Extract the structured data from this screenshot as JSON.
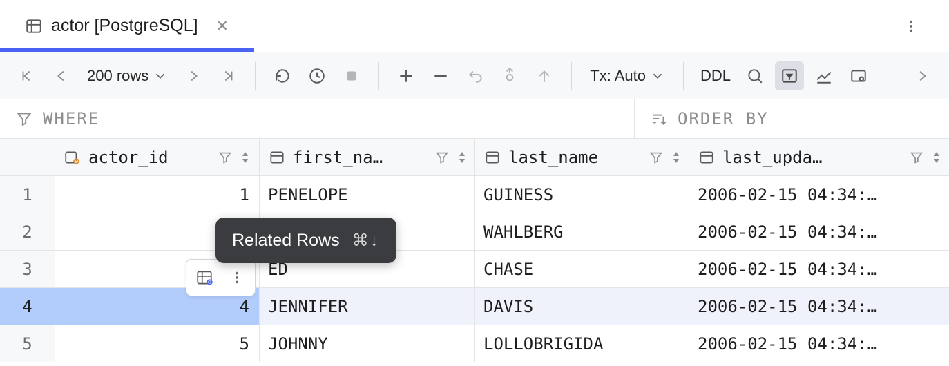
{
  "tab": {
    "title": "actor [PostgreSQL]"
  },
  "toolbar": {
    "rows_label": "200 rows",
    "tx_label": "Tx: Auto",
    "ddl_label": "DDL"
  },
  "filter": {
    "where_label": "WHERE",
    "order_by_label": "ORDER BY"
  },
  "columns": [
    {
      "name": "actor_id"
    },
    {
      "name": "first_na…"
    },
    {
      "name": "last_name"
    },
    {
      "name": "last_upda…"
    }
  ],
  "rows": [
    {
      "idx": "1",
      "actor_id": "1",
      "first_name": "PENELOPE",
      "last_name": "GUINESS",
      "last_update": "2006-02-15 04:34:…"
    },
    {
      "idx": "2",
      "actor_id": "",
      "first_name": "",
      "last_name": "WAHLBERG",
      "last_update": "2006-02-15 04:34:…"
    },
    {
      "idx": "3",
      "actor_id": "",
      "first_name": "ED",
      "last_name": "CHASE",
      "last_update": "2006-02-15 04:34:…"
    },
    {
      "idx": "4",
      "actor_id": "4",
      "first_name": "JENNIFER",
      "last_name": "DAVIS",
      "last_update": "2006-02-15 04:34:…",
      "selected": true
    },
    {
      "idx": "5",
      "actor_id": "5",
      "first_name": "JOHNNY",
      "last_name": "LOLLOBRIGIDA",
      "last_update": "2006-02-15 04:34:…"
    }
  ],
  "tooltip": {
    "label": "Related Rows",
    "shortcut": "⌘↓"
  }
}
